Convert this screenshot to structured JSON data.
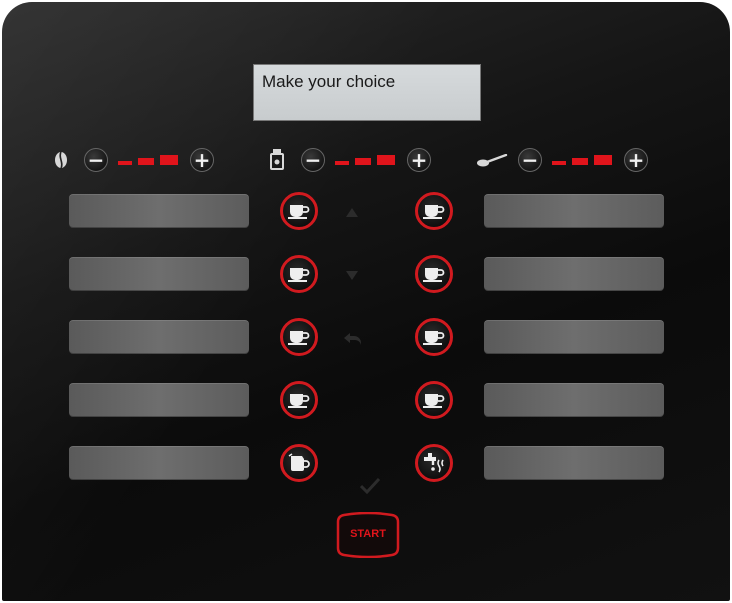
{
  "display": {
    "text": "Make your choice"
  },
  "controls": {
    "bean_strength": {
      "icon": "coffee-bean-icon",
      "minus": "−",
      "plus": "+",
      "level": 3,
      "max": 3
    },
    "milk_amount": {
      "icon": "milk-jug-icon",
      "minus": "−",
      "plus": "+",
      "level": 3,
      "max": 3
    },
    "sugar_amount": {
      "icon": "sugar-spoon-icon",
      "minus": "−",
      "plus": "+",
      "level": 3,
      "max": 3
    }
  },
  "left_buttons": [
    {
      "icon": "cup-icon"
    },
    {
      "icon": "cup-icon"
    },
    {
      "icon": "cup-icon"
    },
    {
      "icon": "cup-icon"
    },
    {
      "icon": "jug-icon"
    }
  ],
  "right_buttons": [
    {
      "icon": "cup-icon"
    },
    {
      "icon": "cup-icon"
    },
    {
      "icon": "cup-icon"
    },
    {
      "icon": "cup-icon"
    },
    {
      "icon": "hot-water-tap-icon"
    }
  ],
  "navigation": {
    "up": "up-arrow-icon",
    "down": "down-arrow-icon",
    "back": "back-arrow-icon",
    "confirm": "checkmark-icon"
  },
  "start": {
    "label": "START"
  },
  "colors": {
    "accent": "#e0141b",
    "panel": "#111111",
    "display_bg": "#cfd3d5"
  }
}
